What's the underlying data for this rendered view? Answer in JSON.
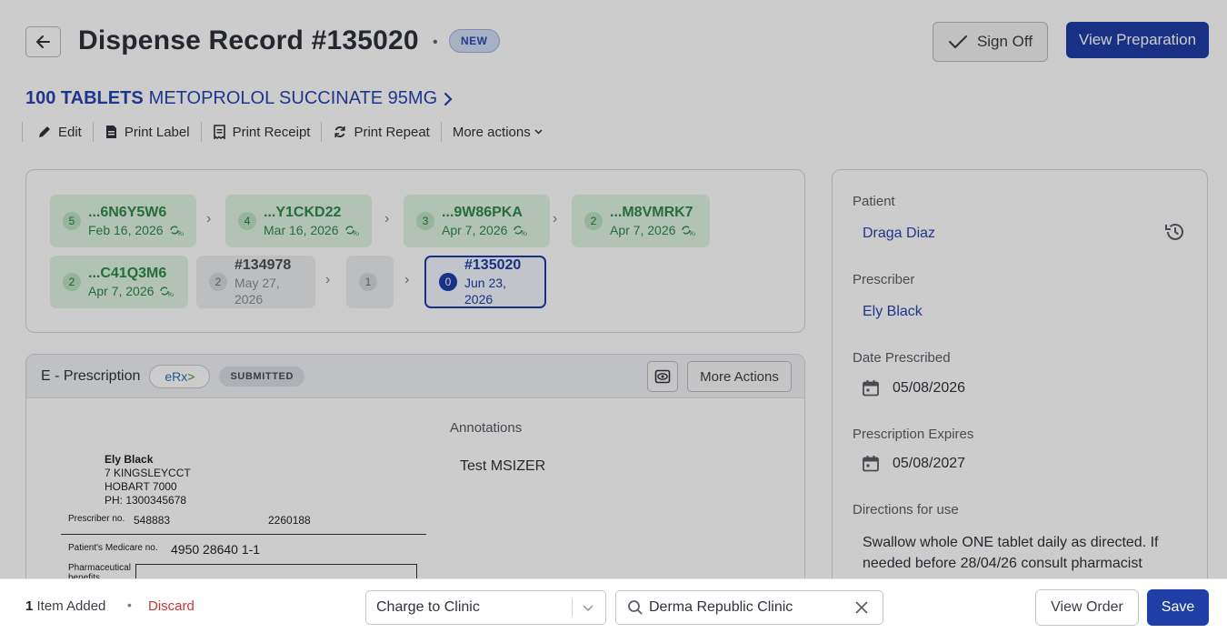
{
  "header": {
    "title": "Dispense Record #135020",
    "separator": "•",
    "status_badge": "NEW",
    "signoff_label": "Sign Off",
    "view_preparation_label": "View Preparation"
  },
  "product": {
    "quantity": "100 TABLETS",
    "name": "METOPROLOL SUCCINATE 95MG"
  },
  "actions": {
    "edit": "Edit",
    "print_label": "Print Label",
    "print_receipt": "Print Receipt",
    "print_repeat": "Print Repeat",
    "more_actions": "More actions"
  },
  "history": {
    "chips": [
      {
        "count": "5",
        "code": "...6N6Y5W6",
        "date": "Feb 16, 2026",
        "style": "green"
      },
      {
        "count": "4",
        "code": "...Y1CKD22",
        "date": "Mar 16, 2026",
        "style": "green"
      },
      {
        "count": "3",
        "code": "...9W86PKA",
        "date": "Apr 7, 2026",
        "style": "green"
      },
      {
        "count": "2",
        "code": "...M8VMRK7",
        "date": "Apr 7, 2026",
        "style": "green"
      },
      {
        "count": "2",
        "code": "...C41Q3M6",
        "date": "Apr 7, 2026",
        "style": "green"
      },
      {
        "count": "2",
        "code": "#134978",
        "date": "May 27, 2026",
        "style": "grey"
      },
      {
        "count": "1",
        "code": "",
        "date": "",
        "style": "grey"
      },
      {
        "count": "0",
        "code": "#135020",
        "date": "Jun 23, 2026",
        "style": "current"
      }
    ]
  },
  "eprescription": {
    "title": "E - Prescription",
    "erx_label": "eRx",
    "status": "SUBMITTED",
    "more_actions": "More Actions",
    "script": {
      "prescriber_name": "Ely Black",
      "address_line1": "7 KINGSLEYCCT",
      "address_line2": "HOBART 7000",
      "phone": "PH: 1300345678",
      "prescriber_no_label": "Prescriber no.",
      "prescriber_no": "548883",
      "prescriber_no_2": "2260188",
      "medicare_label": "Patient's Medicare no.",
      "medicare_no": "4950 28640 1-1",
      "pharm_label": "Pharmaceutical benefits"
    },
    "annotations_title": "Annotations",
    "annotations_text": "Test MSIZER"
  },
  "side": {
    "patient_label": "Patient",
    "patient_name": "Draga Diaz",
    "prescriber_label": "Prescriber",
    "prescriber_name": "Ely Black",
    "date_prescribed_label": "Date Prescribed",
    "date_prescribed": "05/08/2026",
    "expires_label": "Prescription Expires",
    "expires": "05/08/2027",
    "directions_label": "Directions for use",
    "directions": "Swallow whole ONE tablet daily as directed. If needed before 28/04/26 consult pharmacist"
  },
  "bottom": {
    "items_count": "1",
    "items_text": "Item Added",
    "separator": "•",
    "discard": "Discard",
    "charge_option": "Charge to Clinic",
    "search_value": "Derma Republic Clinic",
    "view_order": "View Order",
    "save": "Save"
  },
  "colors": {
    "primary": "#1f3ea6",
    "green_chip": "#dff4e3",
    "danger": "#c43636"
  }
}
